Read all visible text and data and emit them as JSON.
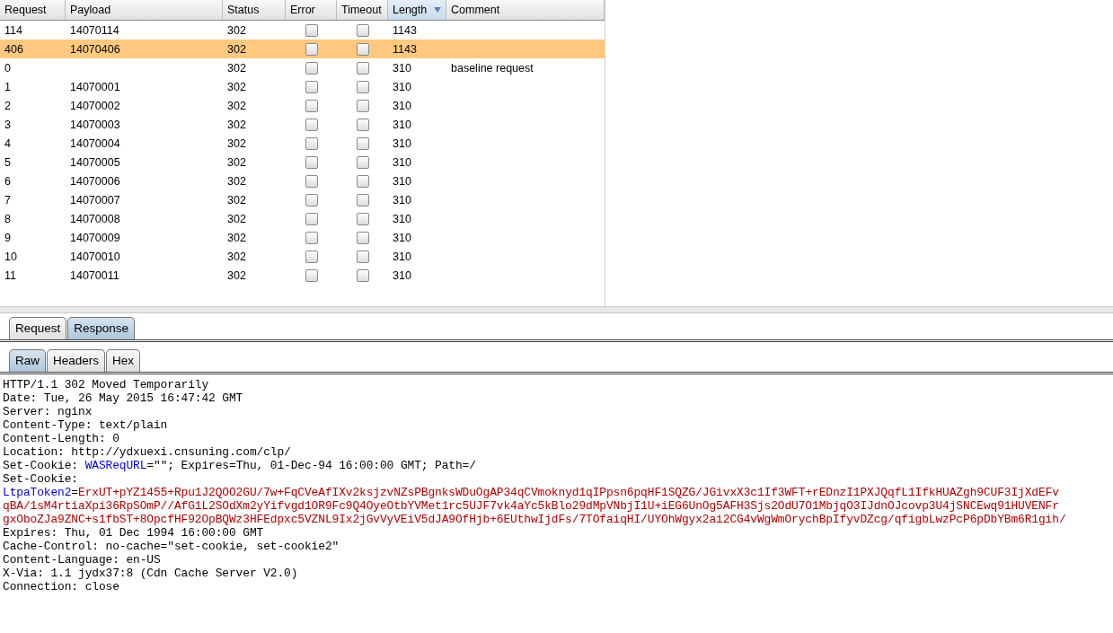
{
  "results_table": {
    "columns": [
      {
        "label": "Request",
        "sorted": false
      },
      {
        "label": "Payload",
        "sorted": false
      },
      {
        "label": "Status",
        "sorted": false
      },
      {
        "label": "Error",
        "sorted": false
      },
      {
        "label": "Timeout",
        "sorted": false
      },
      {
        "label": "Length",
        "sorted": true
      },
      {
        "label": "Comment",
        "sorted": false
      }
    ],
    "rows": [
      {
        "request": "114",
        "payload": "14070114",
        "status": "302",
        "error": false,
        "timeout": false,
        "length": "1143",
        "selected": false
      },
      {
        "request": "406",
        "payload": "14070406",
        "status": "302",
        "error": false,
        "timeout": false,
        "length": "1143",
        "selected": true
      },
      {
        "request": "0",
        "status": "302",
        "error": false,
        "timeout": false,
        "length": "310",
        "comment": "baseline request",
        "selected": false
      },
      {
        "request": "1",
        "payload": "14070001",
        "status": "302",
        "error": false,
        "timeout": false,
        "length": "310",
        "selected": false
      },
      {
        "request": "2",
        "payload": "14070002",
        "status": "302",
        "error": false,
        "timeout": false,
        "length": "310",
        "selected": false
      },
      {
        "request": "3",
        "payload": "14070003",
        "status": "302",
        "error": false,
        "timeout": false,
        "length": "310",
        "selected": false
      },
      {
        "request": "4",
        "payload": "14070004",
        "status": "302",
        "error": false,
        "timeout": false,
        "length": "310",
        "selected": false
      },
      {
        "request": "5",
        "payload": "14070005",
        "status": "302",
        "error": false,
        "timeout": false,
        "length": "310",
        "selected": false
      },
      {
        "request": "6",
        "payload": "14070006",
        "status": "302",
        "error": false,
        "timeout": false,
        "length": "310",
        "selected": false
      },
      {
        "request": "7",
        "payload": "14070007",
        "status": "302",
        "error": false,
        "timeout": false,
        "length": "310",
        "selected": false
      },
      {
        "request": "8",
        "payload": "14070008",
        "status": "302",
        "error": false,
        "timeout": false,
        "length": "310",
        "selected": false
      },
      {
        "request": "9",
        "payload": "14070009",
        "status": "302",
        "error": false,
        "timeout": false,
        "length": "310",
        "selected": false
      },
      {
        "request": "10",
        "payload": "14070010",
        "status": "302",
        "error": false,
        "timeout": false,
        "length": "310",
        "selected": false
      },
      {
        "request": "11",
        "payload": "14070011",
        "status": "302",
        "error": false,
        "timeout": false,
        "length": "310",
        "selected": false
      }
    ]
  },
  "message_tabs": [
    {
      "label": "Request",
      "selected": false
    },
    {
      "label": "Response",
      "selected": true
    }
  ],
  "view_tabs": [
    {
      "label": "Raw",
      "selected": true
    },
    {
      "label": "Headers",
      "selected": false
    },
    {
      "label": "Hex",
      "selected": false
    }
  ],
  "response_lines": [
    [
      {
        "kind": "plain",
        "text": "HTTP/1.1 302 Moved Temporarily"
      }
    ],
    [
      {
        "kind": "plain",
        "text": "Date: Tue, 26 May 2015 16:47:42 GMT"
      }
    ],
    [
      {
        "kind": "plain",
        "text": "Server: nginx"
      }
    ],
    [
      {
        "kind": "plain",
        "text": "Content-Type: text/plain"
      }
    ],
    [
      {
        "kind": "plain",
        "text": "Content-Length: 0"
      }
    ],
    [
      {
        "kind": "plain",
        "text": "Location: http://ydxuexi.cnsuning.com/clp/"
      }
    ],
    [
      {
        "kind": "plain",
        "text": "Set-Cookie: "
      },
      {
        "kind": "name",
        "text": "WASReqURL"
      },
      {
        "kind": "plain",
        "text": "=\"\"; Expires=Thu, 01-Dec-94 16:00:00 GMT; Path=/"
      }
    ],
    [
      {
        "kind": "plain",
        "text": "Set-Cookie:"
      }
    ],
    [
      {
        "kind": "name",
        "text": "LtpaToken2"
      },
      {
        "kind": "plain",
        "text": "="
      },
      {
        "kind": "value",
        "text": "ErxUT+pYZ1455+Rpu1J2QOO2GU/7w+FqCVeAfIXv2ksjzvNZsPBgnksWDuOgAP34qCVmoknyd1qIPpsn6pqHF1SQZG/JGivxX3c1If3WFT+rEDnzI1PXJQqfL1IfkHUAZgh9CUF3IjXdEFv"
      }
    ],
    [
      {
        "kind": "value",
        "text": "qBA/1sM4rtiaXpi36RpSOmP//AfG1L2SOdXm2yYifvgd1OR9Fc9Q4OyeOtbYVMet1rc5UJF7vk4aYc5kBlo29dMpVNbjI1U+iEG6UnOg5AFH3Sjs2OdU7O1MbjqO3IJdnOJcovp3U4jSNCEwq91HUVENFr"
      }
    ],
    [
      {
        "kind": "value",
        "text": "gxOboZJa9ZNC+s1fbST+8OpcfHF92OpBQWz3HFEdpxc5VZNL9Ix2jGvVyVEiV5dJA9OfHjb+6EUthwIjdFs/7TOfaiqHI/UYOhWgyx2ai2CG4vWgWmOrychBpIfyvDZcg/qfigbLwzPcP6pDbYBm6R1gih/"
      }
    ],
    [
      {
        "kind": "plain",
        "text": "Expires: Thu, 01 Dec 1994 16:00:00 GMT"
      }
    ],
    [
      {
        "kind": "plain",
        "text": "Cache-Control: no-cache=\"set-cookie, set-cookie2\""
      }
    ],
    [
      {
        "kind": "plain",
        "text": "Content-Language: en-US"
      }
    ],
    [
      {
        "kind": "plain",
        "text": "X-Via: 1.1 jydx37:8 (Cdn Cache Server V2.0)"
      }
    ],
    [
      {
        "kind": "plain",
        "text": "Connection: close"
      }
    ]
  ]
}
